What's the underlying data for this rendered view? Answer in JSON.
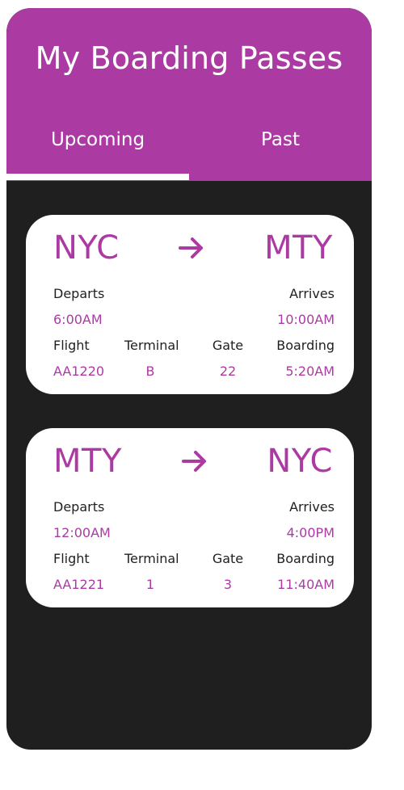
{
  "app": {
    "title": "My Boarding Passes",
    "accent_color": "#ab3aa3",
    "background_color": "#1f1f1f"
  },
  "tabs": [
    {
      "label": "Upcoming",
      "active": true
    },
    {
      "label": "Past",
      "active": false
    }
  ],
  "labels": {
    "departs": "Departs",
    "arrives": "Arrives",
    "flight": "Flight",
    "terminal": "Terminal",
    "gate": "Gate",
    "boarding": "Boarding"
  },
  "passes": [
    {
      "from": "NYC",
      "to": "MTY",
      "departs": "6:00AM",
      "arrives": "10:00AM",
      "flight": "AA1220",
      "terminal": "B",
      "gate": "22",
      "boarding": "5:20AM"
    },
    {
      "from": "MTY",
      "to": "NYC",
      "departs": "12:00AM",
      "arrives": "4:00PM",
      "flight": "AA1221",
      "terminal": "1",
      "gate": "3",
      "boarding": "11:40AM"
    }
  ]
}
